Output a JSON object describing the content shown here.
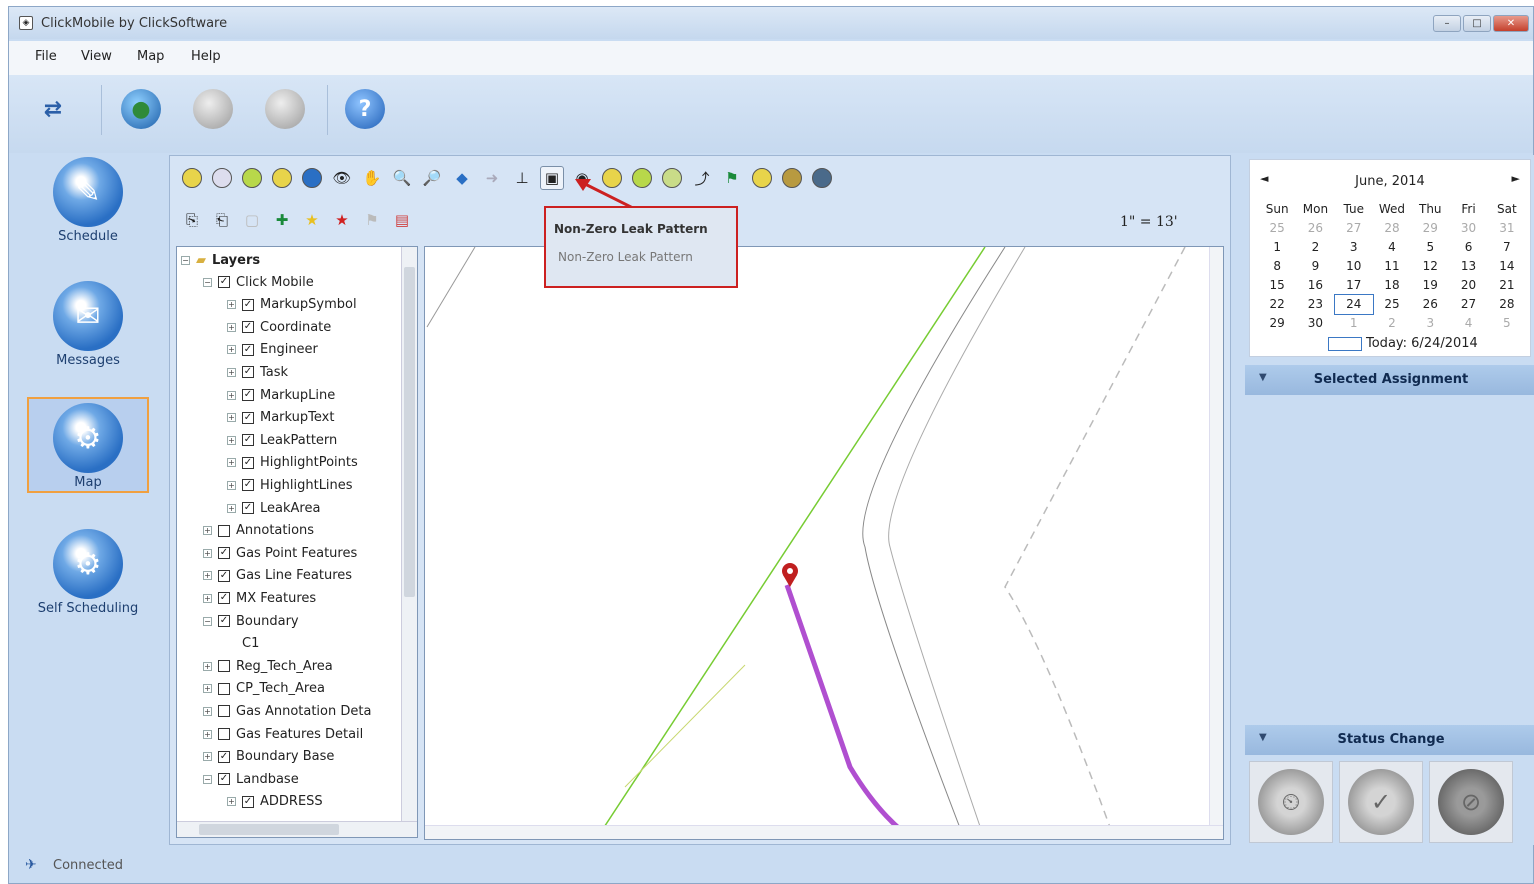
{
  "window": {
    "title": "ClickMobile by ClickSoftware",
    "controls": [
      "–",
      "□",
      "✕"
    ]
  },
  "menu": [
    "File",
    "View",
    "Map",
    "Help"
  ],
  "toolbar": {
    "buttons": [
      "sync",
      "globe",
      "globe-disabled",
      "history-disabled",
      "help"
    ]
  },
  "nav": {
    "items": [
      {
        "label": "Schedule",
        "icon": "schedule-icon"
      },
      {
        "label": "Messages",
        "icon": "messages-icon"
      },
      {
        "label": "Map",
        "icon": "map-gear-icon",
        "active": true
      },
      {
        "label": "Self Scheduling",
        "icon": "self-scheduling-icon"
      }
    ]
  },
  "map_toolbar": {
    "scale": "1\" = 13'",
    "tooltip": {
      "title": "Non-Zero Leak Pattern",
      "subtitle": "Non-Zero Leak Pattern"
    }
  },
  "layers": {
    "root": "Layers",
    "items": [
      {
        "label": "Click Mobile",
        "level": 1,
        "checked": true,
        "expanded": true
      },
      {
        "label": "MarkupSymbol",
        "level": 2,
        "checked": true
      },
      {
        "label": "Coordinate",
        "level": 2,
        "checked": true
      },
      {
        "label": "Engineer",
        "level": 2,
        "checked": true
      },
      {
        "label": "Task",
        "level": 2,
        "checked": true
      },
      {
        "label": "MarkupLine",
        "level": 2,
        "checked": true
      },
      {
        "label": "MarkupText",
        "level": 2,
        "checked": true
      },
      {
        "label": "LeakPattern",
        "level": 2,
        "checked": true
      },
      {
        "label": "HighlightPoints",
        "level": 2,
        "checked": true
      },
      {
        "label": "HighlightLines",
        "level": 2,
        "checked": true
      },
      {
        "label": "LeakArea",
        "level": 2,
        "checked": true
      },
      {
        "label": "Annotations",
        "level": 1,
        "checked": false
      },
      {
        "label": "Gas Point Features",
        "level": 1,
        "checked": true
      },
      {
        "label": "Gas Line Features",
        "level": 1,
        "checked": true
      },
      {
        "label": "MX Features",
        "level": 1,
        "checked": true
      },
      {
        "label": "Boundary",
        "level": 1,
        "checked": true,
        "expanded": true
      },
      {
        "label": "C1",
        "level": 2,
        "checked": null
      },
      {
        "label": "Reg_Tech_Area",
        "level": 1,
        "checked": false
      },
      {
        "label": "CP_Tech_Area",
        "level": 1,
        "checked": false
      },
      {
        "label": "Gas Annotation Deta",
        "level": 1,
        "checked": false
      },
      {
        "label": "Gas Features Detail",
        "level": 1,
        "checked": false
      },
      {
        "label": "Boundary Base",
        "level": 1,
        "checked": true
      },
      {
        "label": "Landbase",
        "level": 1,
        "checked": true,
        "expanded": true
      },
      {
        "label": "ADDRESS",
        "level": 2,
        "checked": true
      }
    ]
  },
  "calendar": {
    "month": "June, 2014",
    "weekdays": [
      "Sun",
      "Mon",
      "Tue",
      "Wed",
      "Thu",
      "Fri",
      "Sat"
    ],
    "weeks": [
      [
        "25",
        "26",
        "27",
        "28",
        "29",
        "30",
        "31"
      ],
      [
        "1",
        "2",
        "3",
        "4",
        "5",
        "6",
        "7"
      ],
      [
        "8",
        "9",
        "10",
        "11",
        "12",
        "13",
        "14"
      ],
      [
        "15",
        "16",
        "17",
        "18",
        "19",
        "20",
        "21"
      ],
      [
        "22",
        "23",
        "24",
        "25",
        "26",
        "27",
        "28"
      ],
      [
        "29",
        "30",
        "1",
        "2",
        "3",
        "4",
        "5"
      ]
    ],
    "today": "Today: 6/24/2014"
  },
  "panels": {
    "selected_assignment": "Selected Assignment",
    "status_change": "Status Change"
  },
  "status": {
    "text": "Connected"
  },
  "colors": {
    "accent": "#3b78c4",
    "leak_line": "#b04fd0",
    "road_line": "#77cc33",
    "highlight_border": "#cc2020"
  }
}
